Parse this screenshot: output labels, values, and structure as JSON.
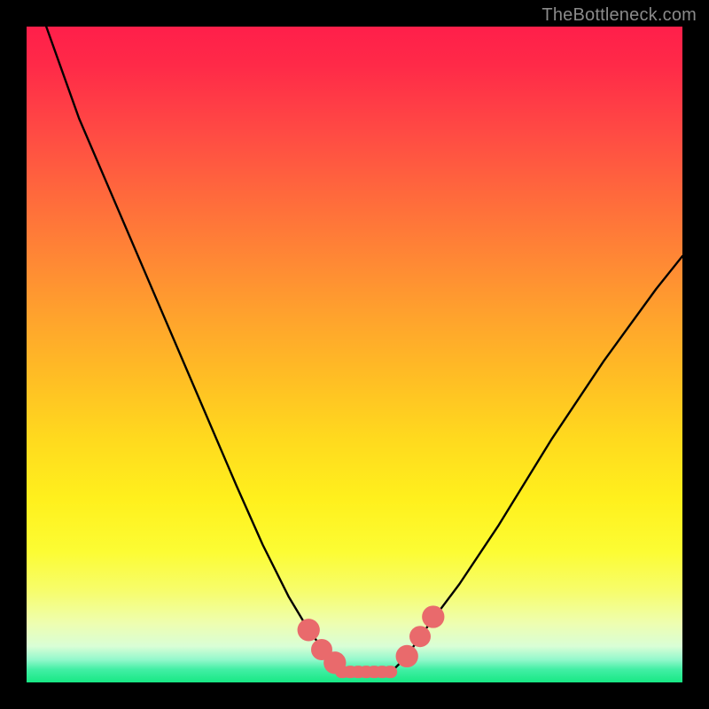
{
  "watermark": {
    "text": "TheBottleneck.com"
  },
  "chart_data": {
    "type": "line",
    "title": "",
    "xlabel": "",
    "ylabel": "",
    "x_range": [
      0,
      100
    ],
    "y_range": [
      0,
      100
    ],
    "series": [
      {
        "name": "bottleneck-curve",
        "x": [
          3,
          8,
          14,
          20,
          26,
          32,
          36,
          40,
          43,
          46,
          48,
          50,
          52,
          54,
          56,
          58,
          60,
          66,
          72,
          80,
          88,
          96,
          100
        ],
        "y": [
          100,
          86,
          72,
          58,
          44,
          30,
          21,
          13,
          8,
          4,
          2,
          1,
          1,
          1,
          2,
          4,
          7,
          15,
          24,
          37,
          49,
          60,
          65
        ]
      }
    ],
    "markers": [
      {
        "name": "left-upper-dot",
        "x": 43,
        "y": 8,
        "r": 1.3
      },
      {
        "name": "left-mid-dot",
        "x": 45,
        "y": 5,
        "r": 1.2
      },
      {
        "name": "left-lower-dot",
        "x": 47,
        "y": 3,
        "r": 1.3
      },
      {
        "name": "right-lower-dot",
        "x": 58,
        "y": 4,
        "r": 1.3
      },
      {
        "name": "right-mid-dot",
        "x": 60,
        "y": 7,
        "r": 1.2
      },
      {
        "name": "right-upper-dot",
        "x": 62,
        "y": 10,
        "r": 1.3
      }
    ],
    "flat_segment": {
      "x0": 48,
      "x1": 56,
      "y": 1.6
    },
    "gradient_stops": [
      {
        "pos": 0,
        "color": "#ff1f4a"
      },
      {
        "pos": 0.45,
        "color": "#ffa22d"
      },
      {
        "pos": 0.75,
        "color": "#fff01d"
      },
      {
        "pos": 0.95,
        "color": "#d9fed6"
      },
      {
        "pos": 1.0,
        "color": "#17e884"
      }
    ],
    "marker_color": "#e96a6c",
    "curve_color": "#000000"
  }
}
